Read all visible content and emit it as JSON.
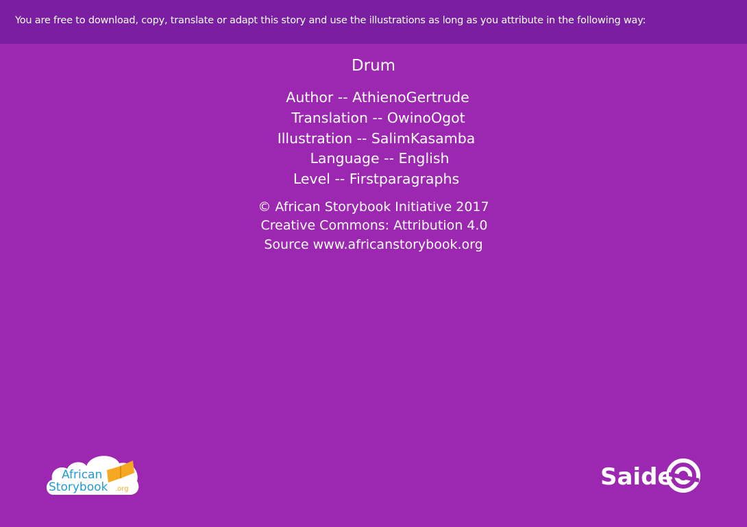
{
  "header": {
    "notice": "You are free to download, copy, translate or adapt this story and use the illustrations as long as you attribute in the following way:"
  },
  "story": {
    "title": "Drum",
    "credits": [
      "Author -- AthienoGertrude",
      "Translation -- OwinoOgot",
      "Illustration -- SalimKasamba",
      "Language -- English",
      "Level -- Firstparagraphs"
    ],
    "license": [
      "© African Storybook Initiative 2017",
      "Creative Commons: Attribution 4.0",
      "Source www.africanstorybook.org"
    ]
  },
  "logos": {
    "african_storybook": {
      "line1": "African",
      "line2": "Storybook",
      "suffix": ".org"
    },
    "saide": {
      "text": "Saide"
    }
  },
  "colors": {
    "page_background": "#9C27B0",
    "header_background": "#7B1FA2",
    "text": "#FFFFFF",
    "asb_blue": "#1E9BD7",
    "asb_orange": "#F7A823"
  }
}
